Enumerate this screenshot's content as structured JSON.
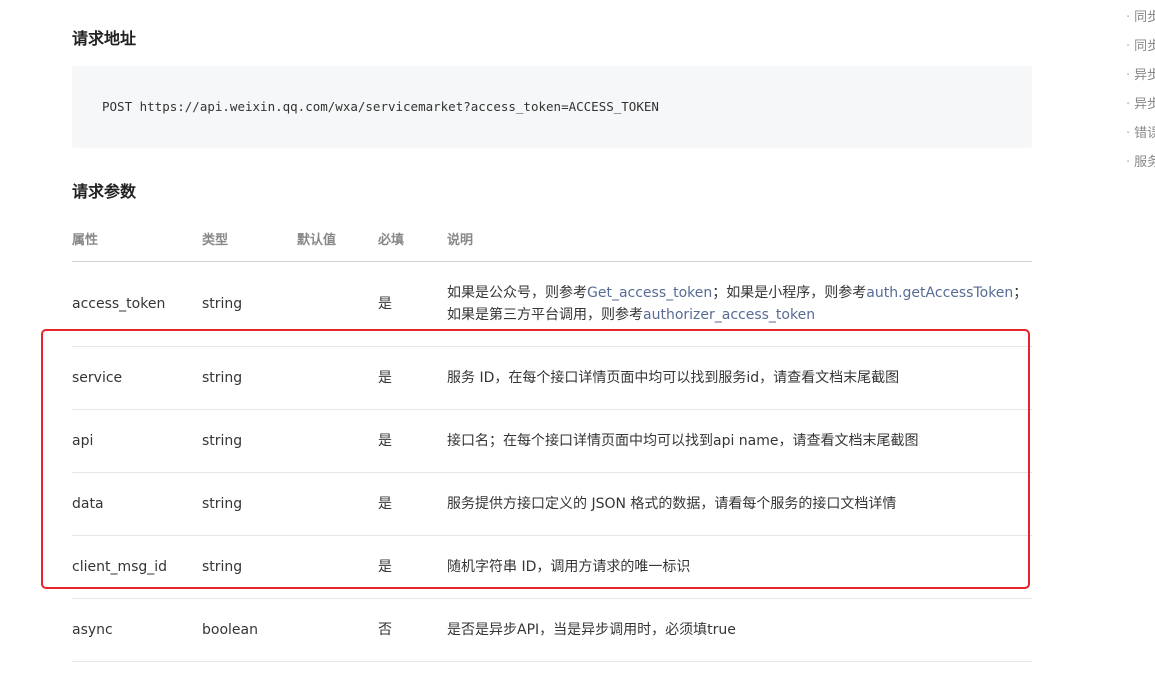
{
  "sections": {
    "request_url_title": "请求地址",
    "request_params_title": "请求参数"
  },
  "code": {
    "request_line": "POST https://api.weixin.qq.com/wxa/servicemarket?access_token=ACCESS_TOKEN"
  },
  "table": {
    "headers": {
      "name": "属性",
      "type": "类型",
      "default": "默认值",
      "required": "必填",
      "description": "说明"
    },
    "rows": [
      {
        "name": "access_token",
        "type": "string",
        "default": "",
        "required": "是",
        "desc_parts": {
          "p1": "如果是公众号，则参考",
          "link1": "Get_access_token",
          "p2": "；如果是小程序，则参考",
          "link2": "auth.getAccessToken",
          "p3": "；如果是第三方平台调用，则参考",
          "link3": "authorizer_access_token"
        }
      },
      {
        "name": "service",
        "type": "string",
        "default": "",
        "required": "是",
        "description": "服务 ID，在每个接口详情页面中均可以找到服务id，请查看文档末尾截图"
      },
      {
        "name": "api",
        "type": "string",
        "default": "",
        "required": "是",
        "description": "接口名；在每个接口详情页面中均可以找到api name，请查看文档末尾截图"
      },
      {
        "name": "data",
        "type": "string",
        "default": "",
        "required": "是",
        "description": "服务提供方接口定义的 JSON 格式的数据，请看每个服务的接口文档详情"
      },
      {
        "name": "client_msg_id",
        "type": "string",
        "default": "",
        "required": "是",
        "description": "随机字符串 ID，调用方请求的唯一标识"
      },
      {
        "name": "async",
        "type": "boolean",
        "default": "",
        "required": "否",
        "description": "是否是异步API，当是异步调用时，必须填true"
      }
    ]
  },
  "toc": {
    "bullet": "·",
    "items": [
      "同步",
      "同步",
      "异步",
      "异步",
      "错误",
      "服务"
    ]
  },
  "colors": {
    "link": "#576b95",
    "highlight": "#e5252b",
    "code_bg": "#f6f7f8"
  }
}
